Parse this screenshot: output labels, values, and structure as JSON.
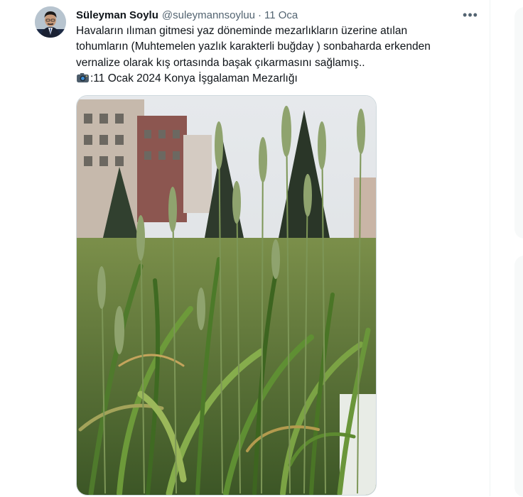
{
  "author": {
    "name": "Süleyman Soylu",
    "handle": "@suleymannsoyluu",
    "separator": "·",
    "date": "11 Oca"
  },
  "tweet": {
    "lines": [
      "Havaların ılıman gitmesi yaz döneminde mezarlıkların üzerine atılan",
      "tohumların (Muhtemelen yazlık karakterli buğday ) sonbaharda erkenden",
      "vernalize olarak kış ortasında başak çıkarmasını sağlamış..",
      ":11 Ocak 2024 Konya İşgalaman Mezarlığı"
    ],
    "line4_icon": "camera-icon"
  },
  "more_icon": "more-options-icon",
  "colors": {
    "text": "#0f1419",
    "secondary": "#536471",
    "border": "#cfd9de"
  }
}
